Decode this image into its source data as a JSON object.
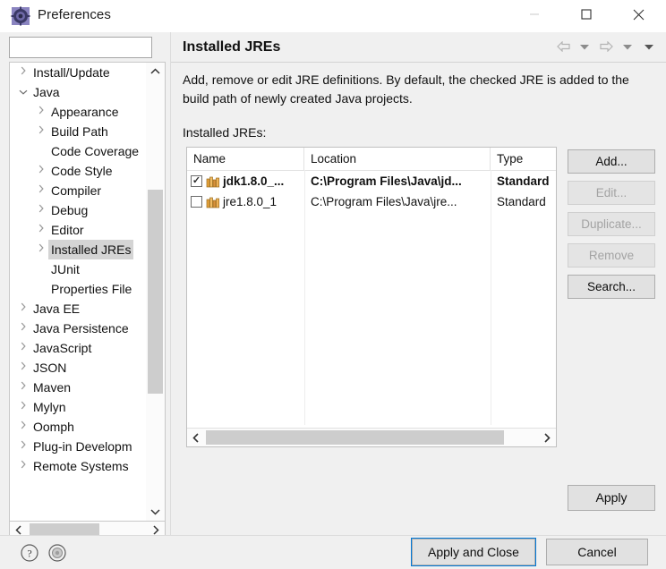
{
  "window": {
    "title": "Preferences",
    "icon": "preferences-gear-icon",
    "controls": {
      "minimize": "—",
      "maximize": "□",
      "close": "✕"
    }
  },
  "sidebar": {
    "filter": {
      "value": "",
      "placeholder": ""
    },
    "items": [
      {
        "label": "Install/Update",
        "level": 0,
        "expander": "collapsed",
        "selected": false
      },
      {
        "label": "Java",
        "level": 0,
        "expander": "expanded",
        "selected": false
      },
      {
        "label": "Appearance",
        "level": 1,
        "expander": "collapsed",
        "selected": false
      },
      {
        "label": "Build Path",
        "level": 1,
        "expander": "collapsed",
        "selected": false
      },
      {
        "label": "Code Coverage",
        "level": 1,
        "expander": "none",
        "selected": false
      },
      {
        "label": "Code Style",
        "level": 1,
        "expander": "collapsed",
        "selected": false
      },
      {
        "label": "Compiler",
        "level": 1,
        "expander": "collapsed",
        "selected": false
      },
      {
        "label": "Debug",
        "level": 1,
        "expander": "collapsed",
        "selected": false
      },
      {
        "label": "Editor",
        "level": 1,
        "expander": "collapsed",
        "selected": false
      },
      {
        "label": "Installed JREs",
        "level": 1,
        "expander": "collapsed",
        "selected": true
      },
      {
        "label": "JUnit",
        "level": 1,
        "expander": "none",
        "selected": false
      },
      {
        "label": "Properties File",
        "level": 1,
        "expander": "none",
        "selected": false
      },
      {
        "label": "Java EE",
        "level": 0,
        "expander": "collapsed",
        "selected": false
      },
      {
        "label": "Java Persistence",
        "level": 0,
        "expander": "collapsed",
        "selected": false
      },
      {
        "label": "JavaScript",
        "level": 0,
        "expander": "collapsed",
        "selected": false
      },
      {
        "label": "JSON",
        "level": 0,
        "expander": "collapsed",
        "selected": false
      },
      {
        "label": "Maven",
        "level": 0,
        "expander": "collapsed",
        "selected": false
      },
      {
        "label": "Mylyn",
        "level": 0,
        "expander": "collapsed",
        "selected": false
      },
      {
        "label": "Oomph",
        "level": 0,
        "expander": "collapsed",
        "selected": false
      },
      {
        "label": "Plug-in Developm",
        "level": 0,
        "expander": "collapsed",
        "selected": false
      },
      {
        "label": "Remote Systems",
        "level": 0,
        "expander": "collapsed",
        "selected": false
      }
    ],
    "scroll_up_icon": "chevron-up-icon",
    "scroll_down_icon": "chevron-down-icon",
    "scroll_left_icon": "chevron-left-icon",
    "scroll_right_icon": "chevron-right-icon"
  },
  "page": {
    "title": "Installed JREs",
    "description": "Add, remove or edit JRE definitions. By default, the checked JRE is added to the build path of newly created Java projects.",
    "list_label": "Installed JREs:",
    "nav": [
      {
        "name": "back-arrow-icon",
        "glyph": "⇦"
      },
      {
        "name": "back-dropdown-icon",
        "glyph": "▾"
      },
      {
        "name": "forward-arrow-icon",
        "glyph": "⇨"
      },
      {
        "name": "forward-dropdown-icon",
        "glyph": "▾"
      },
      {
        "name": "view-menu-icon",
        "glyph": "▾"
      }
    ]
  },
  "table": {
    "columns": [
      "Name",
      "Location",
      "Type"
    ],
    "rows": [
      {
        "checked": true,
        "bold": true,
        "name": "jdk1.8.0_...",
        "location": "C:\\Program Files\\Java\\jd...",
        "type": "Standard"
      },
      {
        "checked": false,
        "bold": false,
        "name": "jre1.8.0_1",
        "location": "C:\\Program Files\\Java\\jre...",
        "type": "Standard"
      }
    ],
    "check_glyph": "✓",
    "scroll_left_icon": "chevron-left-icon",
    "scroll_right_icon": "chevron-right-icon"
  },
  "buttons": {
    "add": {
      "label": "Add...",
      "enabled": true
    },
    "edit": {
      "label": "Edit...",
      "enabled": false
    },
    "duplicate": {
      "label": "Duplicate...",
      "enabled": false
    },
    "remove": {
      "label": "Remove",
      "enabled": false
    },
    "search": {
      "label": "Search...",
      "enabled": true
    },
    "apply": {
      "label": "Apply",
      "enabled": true
    },
    "apply_and_close": {
      "label": "Apply and Close",
      "enabled": true,
      "focused": true
    },
    "cancel": {
      "label": "Cancel",
      "enabled": true
    }
  },
  "footer": {
    "help_icon": "help-question-icon",
    "settings_icon": "oomph-globe-icon"
  },
  "colors": {
    "dialog_bg": "#f0f0f0",
    "field_bg": "#ffffff",
    "button_bg": "#e1e1e1",
    "button_border": "#adadad",
    "focus_border": "#0078d7",
    "selection_bg": "#d4d4d4",
    "scroll_thumb": "#cdcdcd",
    "jre_icon": "#e8a33d"
  }
}
